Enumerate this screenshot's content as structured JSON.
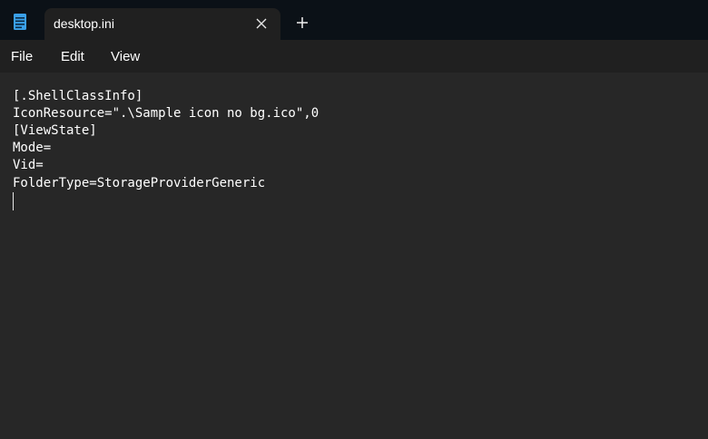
{
  "window": {
    "tab_title": "desktop.ini",
    "new_tab_symbol": "+",
    "app_icon": "notepad-icon",
    "close_icon": "close-icon"
  },
  "menu": {
    "items": [
      "File",
      "Edit",
      "View"
    ]
  },
  "document": {
    "lines": [
      "[.ShellClassInfo]",
      "IconResource=\".\\Sample icon no bg.ico\",0",
      "[ViewState]",
      "Mode=",
      "Vid=",
      "FolderType=StorageProviderGeneric"
    ]
  },
  "colors": {
    "titlebar_bg": "#0b1117",
    "tab_bg": "#202020",
    "editor_bg": "#272727",
    "text": "#ffffff",
    "icon_accent": "#3aa0e8"
  }
}
